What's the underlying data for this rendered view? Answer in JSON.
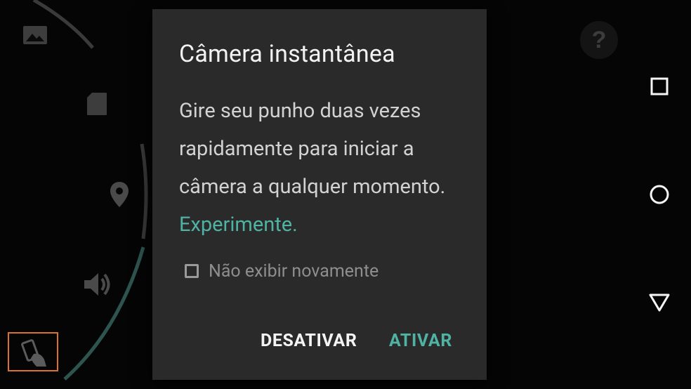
{
  "dialog": {
    "title": "Câmera instantânea",
    "body_text": "Gire seu punho duas vezes rapidamente para iniciar a câmera a qualquer momento.",
    "link_text": "Experimente.",
    "checkbox_label": "Não exibir novamente",
    "checkbox_checked": false,
    "deactivate_label": "DESATIVAR",
    "activate_label": "ATIVAR"
  },
  "help": {
    "label": "?"
  },
  "side_icons": [
    "gallery-icon",
    "sd-card-icon",
    "location-icon",
    "volume-icon",
    "gesture-wrist-icon"
  ],
  "nav": [
    "recents-button",
    "home-button",
    "back-button"
  ],
  "colors": {
    "accent": "#4fb3a4",
    "dialog_bg": "#2a2a2a",
    "screen_bg": "#050505",
    "highlight": "#d9722e"
  }
}
